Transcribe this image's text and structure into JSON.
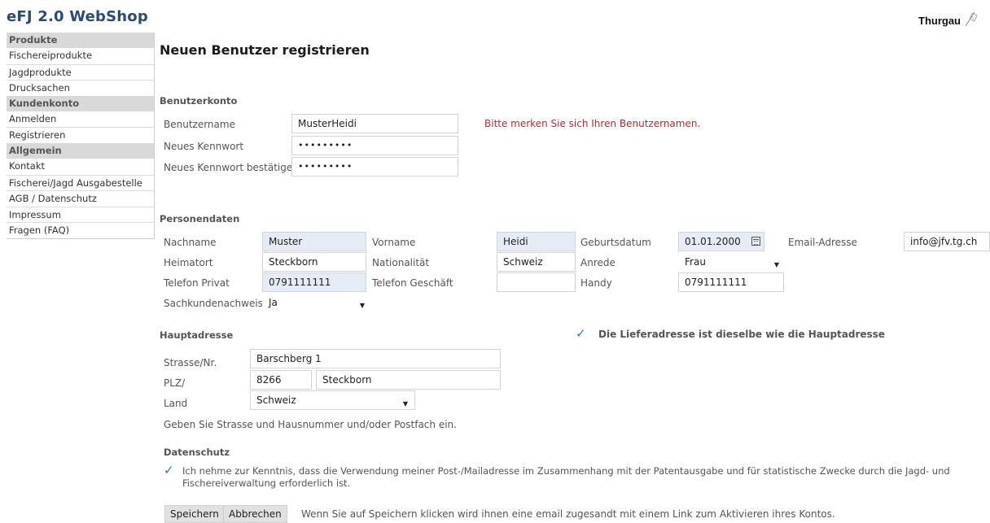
{
  "app": {
    "title": "eFJ 2.0 WebShop",
    "brand": "Thurgau",
    "accent_color": "#2a4a78",
    "brand_icon": "canton-flag-icon"
  },
  "sidebar": {
    "groups": [
      {
        "heading": "Produkte",
        "items": [
          "Fischereiprodukte",
          "Jagdprodukte",
          "Drucksachen"
        ]
      },
      {
        "heading": "Kundenkonto",
        "items": [
          "Anmelden",
          "Registrieren"
        ]
      },
      {
        "heading": "Allgemein",
        "items": [
          "Kontakt",
          "Fischerei/Jagd Ausgabestelle",
          "AGB / Datenschutz",
          "Impressum",
          "Fragen (FAQ)"
        ]
      }
    ]
  },
  "page": {
    "title": "Neuen Benutzer registrieren"
  },
  "account": {
    "heading": "Benutzerkonto",
    "username_label": "Benutzername",
    "username_value": "MusterHeidi",
    "username_hint": "Bitte merken Sie sich Ihren Benutzernamen.",
    "password_label": "Neues Kennwort",
    "password_value": "•••••••••",
    "confirm_label": "Neues Kennwort bestätigen",
    "confirm_value": "•••••••••"
  },
  "person": {
    "heading": "Personendaten",
    "lastname_label": "Nachname",
    "lastname_value": "Muster",
    "firstname_label": "Vorname",
    "firstname_value": "Heidi",
    "birthdate_label": "Geburtsdatum",
    "birthdate_value": "01.01.2000",
    "email_label": "Email-Adresse",
    "email_value": "info@jfv.tg.ch",
    "hometown_label": "Heimatort",
    "hometown_value": "Steckborn",
    "nationality_label": "Nationalität",
    "nationality_value": "Schweiz",
    "salutation_label": "Anrede",
    "salutation_value": "Frau",
    "phone_private_label": "Telefon Privat",
    "phone_private_value": "0791111111",
    "phone_business_label": "Telefon Geschäft",
    "phone_business_value": "",
    "mobile_label": "Handy",
    "mobile_value": "0791111111",
    "competence_label": "Sachkundenachweis",
    "competence_value": "Ja"
  },
  "address": {
    "heading": "Hauptadresse",
    "same_address_label": "Die Lieferadresse ist dieselbe wie die Hauptadresse",
    "same_address_checked": true,
    "street_label": "Strasse/Nr.",
    "street_value": "Barschberg 1",
    "zip_label": "PLZ/",
    "zip_value": "8266",
    "city_value": "Steckborn",
    "country_label": "Land",
    "country_value": "Schweiz",
    "note": "Geben Sie Strasse und Hausnummer und/oder Postfach ein."
  },
  "privacy": {
    "heading": "Datenschutz",
    "checked": true,
    "text_line1": "Ich nehme zur Kenntnis, dass die Verwendung meiner Post-/Mailadresse im Zusammenhang mit der Patentausgabe und für statistische Zwecke durch die Jagd- und",
    "text_line2": "Fischereiverwaltung erforderlich ist."
  },
  "actions": {
    "save_label": "Speichern",
    "cancel_label": "Abbrechen",
    "info": "Wenn Sie auf Speichern klicken wird ihnen eine email zugesandt mit einem Link zum Aktivieren ihres Kontos."
  }
}
